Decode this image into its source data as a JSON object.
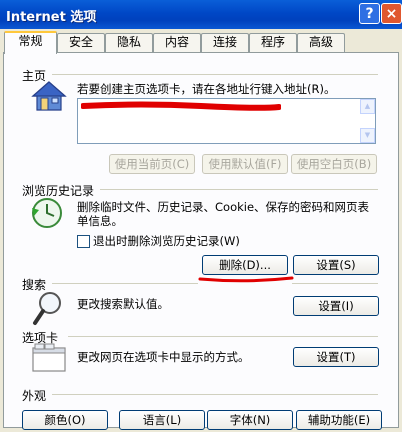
{
  "window": {
    "title": "Internet 选项",
    "help_glyph": "?",
    "close_glyph": "×"
  },
  "tabs": [
    {
      "label": "常规"
    },
    {
      "label": "安全"
    },
    {
      "label": "隐私"
    },
    {
      "label": "内容"
    },
    {
      "label": "连接"
    },
    {
      "label": "程序"
    },
    {
      "label": "高级"
    }
  ],
  "homepage": {
    "heading": "主页",
    "description": "若要创建主页选项卡，请在各地址行键入地址(R)。",
    "buttons": [
      "使用当前页(C)",
      "使用默认值(F)",
      "使用空白页(B)"
    ]
  },
  "history": {
    "heading": "浏览历史记录",
    "description": "删除临时文件、历史记录、Cookie、保存的密码和网页表单信息。",
    "checkbox_label": "退出时删除浏览历史记录(W)",
    "delete_button": "删除(D)...",
    "settings_button": "设置(S)"
  },
  "search": {
    "heading": "搜索",
    "description": "更改搜索默认值。",
    "settings_button": "设置(I)"
  },
  "tabs_section": {
    "heading": "选项卡",
    "description": "更改网页在选项卡中显示的方式。",
    "settings_button": "设置(T)"
  },
  "appearance": {
    "heading": "外观",
    "buttons": [
      "颜色(O)",
      "语言(L)",
      "字体(N)",
      "辅助功能(E)"
    ]
  },
  "colors": {
    "titlebar": "#0047c6",
    "annotation": "#e00000",
    "panel": "#fcfcfe",
    "dialog": "#ece9d8"
  }
}
